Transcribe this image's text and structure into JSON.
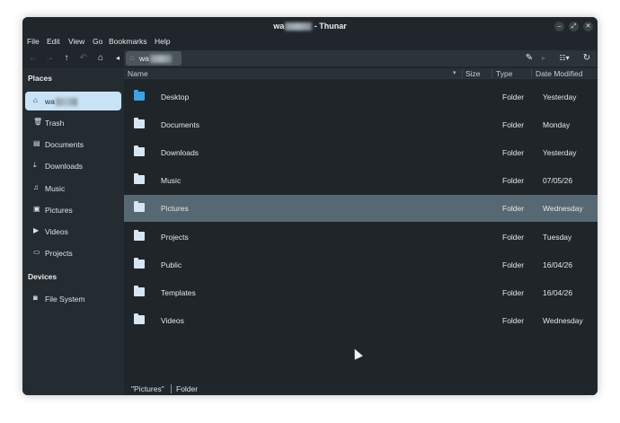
{
  "window": {
    "title_prefix": "wa",
    "title_suffix": " - Thunar"
  },
  "wm_buttons": {
    "minimize": "–",
    "maximize": "⤢",
    "close": "✕"
  },
  "menu": [
    "File",
    "Edit",
    "View",
    "Go",
    "Bookmarks",
    "Help"
  ],
  "toolbar": {
    "back": "←",
    "forward": "→",
    "up": "↑",
    "undo": "↶",
    "home": "⌂",
    "collapse": "◂",
    "path_label": "wa",
    "path_home": "⌂",
    "next": "▸",
    "edit": "✎",
    "view_mode": "☷▾",
    "reload": "↻"
  },
  "sidebar": {
    "places_heading": "Places",
    "places": [
      {
        "label": "wa",
        "icon": "⌂",
        "icon_name": "home-icon"
      },
      {
        "label": "Trash",
        "icon": "🗑",
        "icon_name": "trash-icon"
      },
      {
        "label": "Documents",
        "icon": "▤",
        "icon_name": "document-icon"
      },
      {
        "label": "Downloads",
        "icon": "⤓",
        "icon_name": "download-icon"
      },
      {
        "label": "Music",
        "icon": "♫",
        "icon_name": "music-icon"
      },
      {
        "label": "Pictures",
        "icon": "▣",
        "icon_name": "picture-icon"
      },
      {
        "label": "Videos",
        "icon": "▶",
        "icon_name": "video-icon"
      },
      {
        "label": "Projects",
        "icon": "▭",
        "icon_name": "folder-icon"
      }
    ],
    "devices_heading": "Devices",
    "devices": [
      {
        "label": "File System",
        "icon": "◙",
        "icon_name": "drive-icon"
      }
    ]
  },
  "columns": {
    "name": "Name",
    "sort": "▾",
    "size": "Size",
    "type": "Type",
    "date": "Date Modified"
  },
  "files": [
    {
      "name": "Desktop",
      "type": "Folder",
      "date": "Yesterday"
    },
    {
      "name": "Documents",
      "type": "Folder",
      "date": "Monday"
    },
    {
      "name": "Downloads",
      "type": "Folder",
      "date": "Yesterday"
    },
    {
      "name": "Music",
      "type": "Folder",
      "date": "07/05/26"
    },
    {
      "name": "Pictures",
      "type": "Folder",
      "date": "Wednesday"
    },
    {
      "name": "Projects",
      "type": "Folder",
      "date": "Tuesday"
    },
    {
      "name": "Public",
      "type": "Folder",
      "date": "16/04/26"
    },
    {
      "name": "Templates",
      "type": "Folder",
      "date": "16/04/26"
    },
    {
      "name": "Videos",
      "type": "Folder",
      "date": "Wednesday"
    }
  ],
  "status": {
    "selection": "\"Pictures\"",
    "type": "Folder"
  },
  "colors": {
    "window_bg": "#20262b",
    "selected_row": "#566872",
    "sidebar_active": "#c8e2f6",
    "home_accent": "#e07b42"
  }
}
